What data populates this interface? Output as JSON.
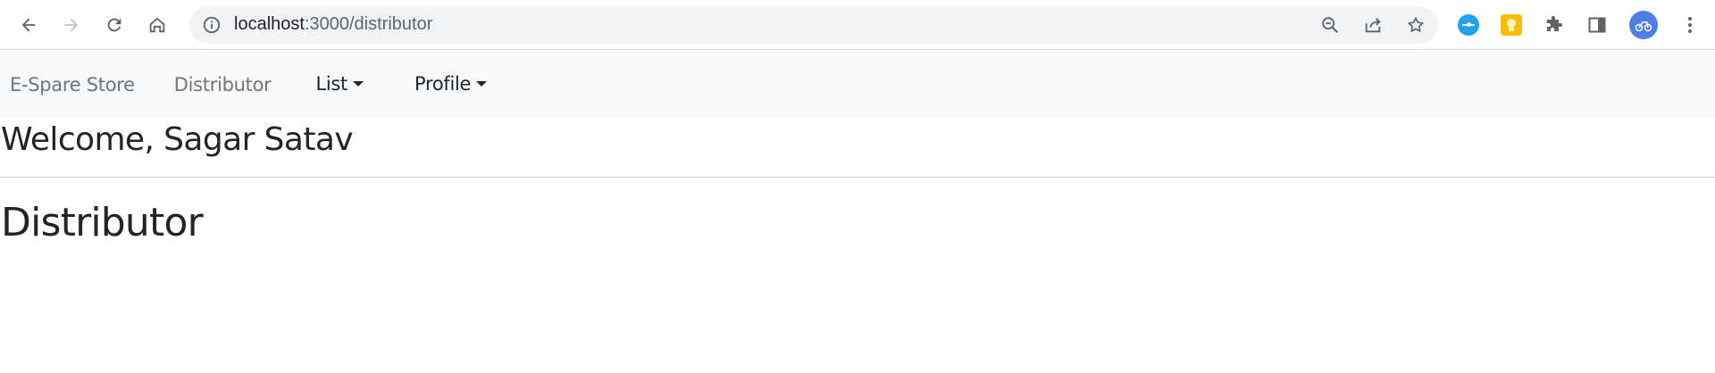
{
  "browser": {
    "url_host": "localhost",
    "url_rest": ":3000/distributor",
    "icons": {
      "back": "arrow-left-icon",
      "forward": "arrow-right-icon",
      "reload": "reload-icon",
      "home": "home-icon",
      "site_info": "info-icon",
      "zoom": "zoom-out-icon",
      "share": "share-icon",
      "bookmark": "star-icon",
      "extension_1": "blue-extension-icon",
      "extension_2": "yellow-extension-icon",
      "extensions": "puzzle-icon",
      "side_panel": "side-panel-icon",
      "profile": "avatar-icon",
      "menu": "kebab-menu-icon"
    }
  },
  "navbar": {
    "brand": "E-Spare Store",
    "link": "Distributor",
    "dropdowns": [
      {
        "label": "List"
      },
      {
        "label": "Profile"
      }
    ]
  },
  "main": {
    "welcome": "Welcome, Sagar Satav",
    "title": "Distributor"
  },
  "colors": {
    "navbar_bg": "#f8f9fa",
    "muted_text": "#6c757d",
    "body_text": "#212529",
    "omnibox_bg": "#f1f3f4"
  }
}
